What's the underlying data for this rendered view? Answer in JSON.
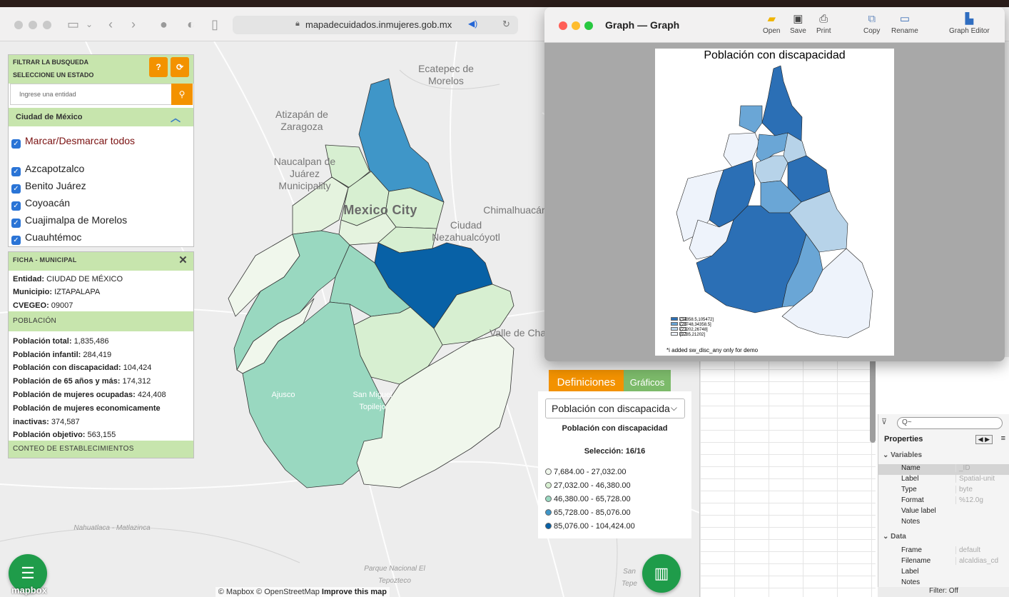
{
  "browser": {
    "url": "mapadecuidados.inmujeres.gob.mx"
  },
  "map": {
    "places": {
      "ecatepec": "Ecatepec de Morelos",
      "atizapan": "Atizapán de Zaragoza",
      "naucalpan": "Naucalpan de Juárez Municipality",
      "mexico_city": "Mexico City",
      "chimalhuacan": "Chimalhuacán",
      "neza": "Ciudad Nezahualcóyotl",
      "valle_chalco": "Valle de Cha",
      "ajusco": "Ajusco",
      "san_miguel": "San Miguel Topilejo",
      "nahuatlaca": "Nahuatlaca - Matlazinca",
      "parque": "Parque Nacional El Tepozteco",
      "tepe": "San Tepe"
    },
    "attribution": "© Mapbox © OpenStreetMap",
    "attribution_link": "Improve this map",
    "mapbox_logo": "mapbox",
    "legend_colors": [
      "#f0f7ec",
      "#d7efd1",
      "#99d8c0",
      "#3f96c8",
      "#0861a6"
    ]
  },
  "filter": {
    "title": "FILTRAR LA BUSQUEDA",
    "subtitle": "SELECCIONE UN ESTADO",
    "help_label": "?",
    "refresh_icon": "refresh-icon",
    "search_placeholder": "Ingrese una entidad",
    "state": "Ciudad de México",
    "master_toggle": "Marcar/Desmarcar todos",
    "municipios": [
      "Azcapotzalco",
      "Benito Juárez",
      "Coyoacán",
      "Cuajimalpa de Morelos",
      "Cuauhtémoc"
    ]
  },
  "ficha": {
    "title": "FICHA - MUNICIPAL",
    "entidad_label": "Entidad:",
    "entidad": "CIUDAD DE MÉXICO",
    "municipio_label": "Municipio:",
    "municipio": "IZTAPALAPA",
    "cvegeo_label": "CVEGEO:",
    "cvegeo": "09007",
    "poblacion_header": "POBLACIÓN",
    "rows": [
      {
        "label": "Población total:",
        "value": "1,835,486"
      },
      {
        "label": "Población infantil:",
        "value": "284,419"
      },
      {
        "label": "Población con discapacidad:",
        "value": "104,424"
      },
      {
        "label": "Población de 65 años y más:",
        "value": "174,312"
      },
      {
        "label": "Población de mujeres ocupadas:",
        "value": "424,408"
      },
      {
        "label": "Población de mujeres economicamente",
        "value": ""
      },
      {
        "label": "inactivas:",
        "value": "374,587"
      },
      {
        "label": "Población objetivo:",
        "value": "563,155"
      }
    ],
    "conteo_header": "CONTEO DE ESTABLECIMIENTOS"
  },
  "controls": {
    "tab_definiciones": "Definiciones",
    "tab_graficos": "Gráficos",
    "select_value": "Población con discapacida",
    "legend_title": "Población con discapacidad",
    "selection": "Selección: 16/16",
    "ranges": [
      "7,684.00 - 27,032.00",
      "27,032.00 - 46,380.00",
      "46,380.00 - 65,728.00",
      "65,728.00 - 85,076.00",
      "85,076.00 - 104,424.00"
    ]
  },
  "graph": {
    "window_title": "Graph — Graph",
    "buttons": [
      "Open",
      "Save",
      "Print",
      "Copy",
      "Rename",
      "Graph Editor"
    ],
    "chart_title": "Población con discapacidad",
    "legend": [
      "(34358.5,105472]",
      "(26748,34358.5]",
      "(21202,26748]",
      "[9735,21202]"
    ],
    "legend_colors": [
      "#2b6fb5",
      "#6aa6d6",
      "#b7d3e9",
      "#eef3fb"
    ],
    "note": "*i added sw_disc_any only for demo"
  },
  "stata": {
    "filter_placeholder": "Q~",
    "properties_title": "Properties",
    "variables_header": "Variables",
    "variables": [
      {
        "k": "Name",
        "v": "_ID"
      },
      {
        "k": "Label",
        "v": "Spatial-unit"
      },
      {
        "k": "Type",
        "v": "byte"
      },
      {
        "k": "Format",
        "v": "%12.0g"
      },
      {
        "k": "Value label",
        "v": ""
      },
      {
        "k": "Notes",
        "v": ""
      }
    ],
    "data_header": "Data",
    "data": [
      {
        "k": "Frame",
        "v": "default"
      },
      {
        "k": "Filename",
        "v": "alcaldias_cd"
      },
      {
        "k": "Label",
        "v": ""
      },
      {
        "k": "Notes",
        "v": ""
      }
    ],
    "filter_status": "Filter: Off"
  }
}
